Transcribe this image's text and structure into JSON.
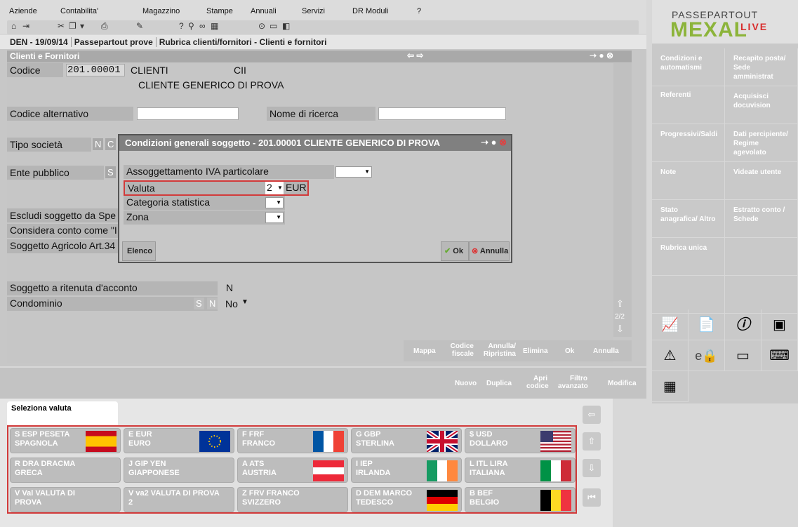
{
  "menu": [
    "Aziende",
    "Contabilita'",
    "Magazzino",
    "Stampe",
    "Annuali",
    "Servizi",
    "DR Moduli",
    "?"
  ],
  "titlebar": {
    "part1": "DEN - 19/09/14",
    "part2": "Passepartout prove",
    "part3": "Rubrica clienti/fornitori - Clienti e fornitori"
  },
  "main": {
    "header": "Clienti e Fornitori",
    "codice_label": "Codice",
    "codice_value": "201.00001",
    "codice_type": "CLIENTI",
    "codice_flag": "CII",
    "nome": "CLIENTE GENERICO DI PROVA",
    "codice_alt_label": "Codice alternativo",
    "nome_ricerca_label": "Nome di ricerca",
    "tipo_societa_label": "Tipo società",
    "tipo_seg1": "N",
    "tipo_seg2": "C",
    "ente_pubblico_label": "Ente pubblico",
    "ente_seg": "S",
    "escludi_label": "Escludi soggetto da Spe",
    "considera_label": "Considera conto come \"I",
    "agricolo_label": "Soggetto Agricolo Art.34",
    "ritenuta_label": "Soggetto a ritenuta d'acconto",
    "ritenuta_value": "N",
    "condominio_label": "Condominio",
    "cond_s": "S",
    "cond_n": "N",
    "cond_value": "No",
    "page": "2/2"
  },
  "actions1": [
    "Mappa",
    "Codice fiscale",
    "Annulla/ Ripristina",
    "Elimina",
    "Ok",
    "Annulla"
  ],
  "actions2": [
    "Nuovo",
    "Duplica",
    "Apri codice",
    "Filtro avanzato",
    "Modifica"
  ],
  "dialog": {
    "title": "Condizioni generali soggetto - 201.00001 CLIENTE GENERICO DI PROVA",
    "iva_label": "Assoggettamento IVA particolare",
    "valuta_label": "Valuta",
    "valuta_code": "2",
    "valuta_name": "EUR",
    "categoria_label": "Categoria statistica",
    "zona_label": "Zona",
    "elenco": "Elenco",
    "ok": "Ok",
    "annulla": "Annulla"
  },
  "logo": {
    "top": "PASSEPARTOUT",
    "main": "MEXAL",
    "live": "LIVE"
  },
  "right_buttons": [
    "Condizioni e automatismi",
    "Recapito posta/ Sede amministrat",
    "Referenti",
    "Acquisisci docuvision",
    "Progressivi/Saldi",
    "Dati percipiente/ Regime agevolato",
    "Note",
    "Videate utente",
    "Stato anagrafica/ Altro",
    "Estratto conto / Schede",
    "Rubrica unica"
  ],
  "selection": {
    "label": "Seleziona valuta"
  },
  "currencies": [
    {
      "l1": "S ESP PESETA",
      "l2": "SPAGNOLA",
      "flag": "es"
    },
    {
      "l1": "E EUR",
      "l2": "EURO",
      "flag": "eu"
    },
    {
      "l1": "F FRF",
      "l2": "FRANCO",
      "flag": "fr"
    },
    {
      "l1": "G GBP",
      "l2": "STERLINA",
      "flag": "gb"
    },
    {
      "l1": "$ USD",
      "l2": "DOLLARO",
      "flag": "us"
    },
    {
      "l1": "R DRA DRACMA",
      "l2": "GRECA",
      "flag": ""
    },
    {
      "l1": "J GIP YEN",
      "l2": "GIAPPONESE",
      "flag": ""
    },
    {
      "l1": "A ATS",
      "l2": "AUSTRIA",
      "flag": "at"
    },
    {
      "l1": "I IEP",
      "l2": "IRLANDA",
      "flag": "ie"
    },
    {
      "l1": "L ITL LIRA",
      "l2": "ITALIANA",
      "flag": "it"
    },
    {
      "l1": "V Val VALUTA DI",
      "l2": "PROVA",
      "flag": ""
    },
    {
      "l1": "V va2 VALUTA DI PROVA",
      "l2": "2",
      "flag": ""
    },
    {
      "l1": "Z FRV FRANCO",
      "l2": "SVIZZERO",
      "flag": ""
    },
    {
      "l1": "D DEM MARCO",
      "l2": "TEDESCO",
      "flag": "de"
    },
    {
      "l1": "B BEF",
      "l2": "BELGIO",
      "flag": "be"
    }
  ]
}
